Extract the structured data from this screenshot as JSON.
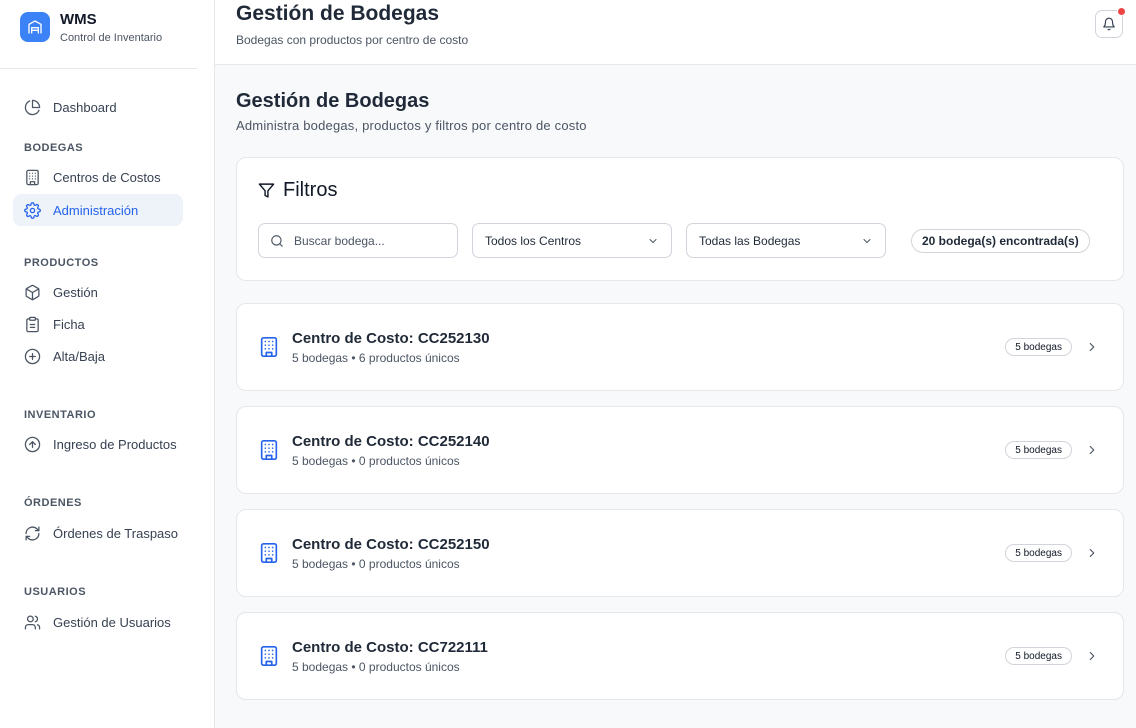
{
  "brand": {
    "title": "WMS",
    "subtitle": "Control de Inventario"
  },
  "nav": {
    "dashboard": "Dashboard",
    "sections": {
      "bodegas": "BODEGAS",
      "productos": "PRODUCTOS",
      "inventario": "INVENTARIO",
      "ordenes": "ÓRDENES",
      "usuarios": "USUARIOS"
    },
    "items": {
      "centros_costos": "Centros de Costos",
      "administracion": "Administración",
      "gestion": "Gestión",
      "ficha": "Ficha",
      "alta_baja": "Alta/Baja",
      "ingreso_productos": "Ingreso de Productos",
      "ordenes_traspaso": "Órdenes de Traspaso",
      "gestion_usuarios": "Gestión de Usuarios"
    },
    "active": "administracion",
    "active_color": "#2563eb"
  },
  "topbar": {
    "title": "Gestión de Bodegas",
    "subtitle": "Bodegas con productos por centro de costo",
    "notification_dot": true
  },
  "page": {
    "title": "Gestión de Bodegas",
    "subtitle": "Administra bodegas, productos y filtros por centro de costo"
  },
  "filters": {
    "title": "Filtros",
    "search_placeholder": "Buscar bodega...",
    "centro_select": "Todos los Centros",
    "bodega_select": "Todas las Bodegas",
    "count": "20 bodega(s) encontrada(s)"
  },
  "centros": [
    {
      "title": "Centro de Costo: CC252130",
      "subtitle": "5 bodegas • 6 productos únicos",
      "badge": "5 bodegas"
    },
    {
      "title": "Centro de Costo: CC252140",
      "subtitle": "5 bodegas • 0 productos únicos",
      "badge": "5 bodegas"
    },
    {
      "title": "Centro de Costo: CC252150",
      "subtitle": "5 bodegas • 0 productos únicos",
      "badge": "5 bodegas"
    },
    {
      "title": "Centro de Costo: CC722111",
      "subtitle": "5 bodegas • 0 productos únicos",
      "badge": "5 bodegas"
    }
  ],
  "colors": {
    "brand": "#3b82f6",
    "accent": "#2563eb",
    "alert": "#ef4444"
  }
}
